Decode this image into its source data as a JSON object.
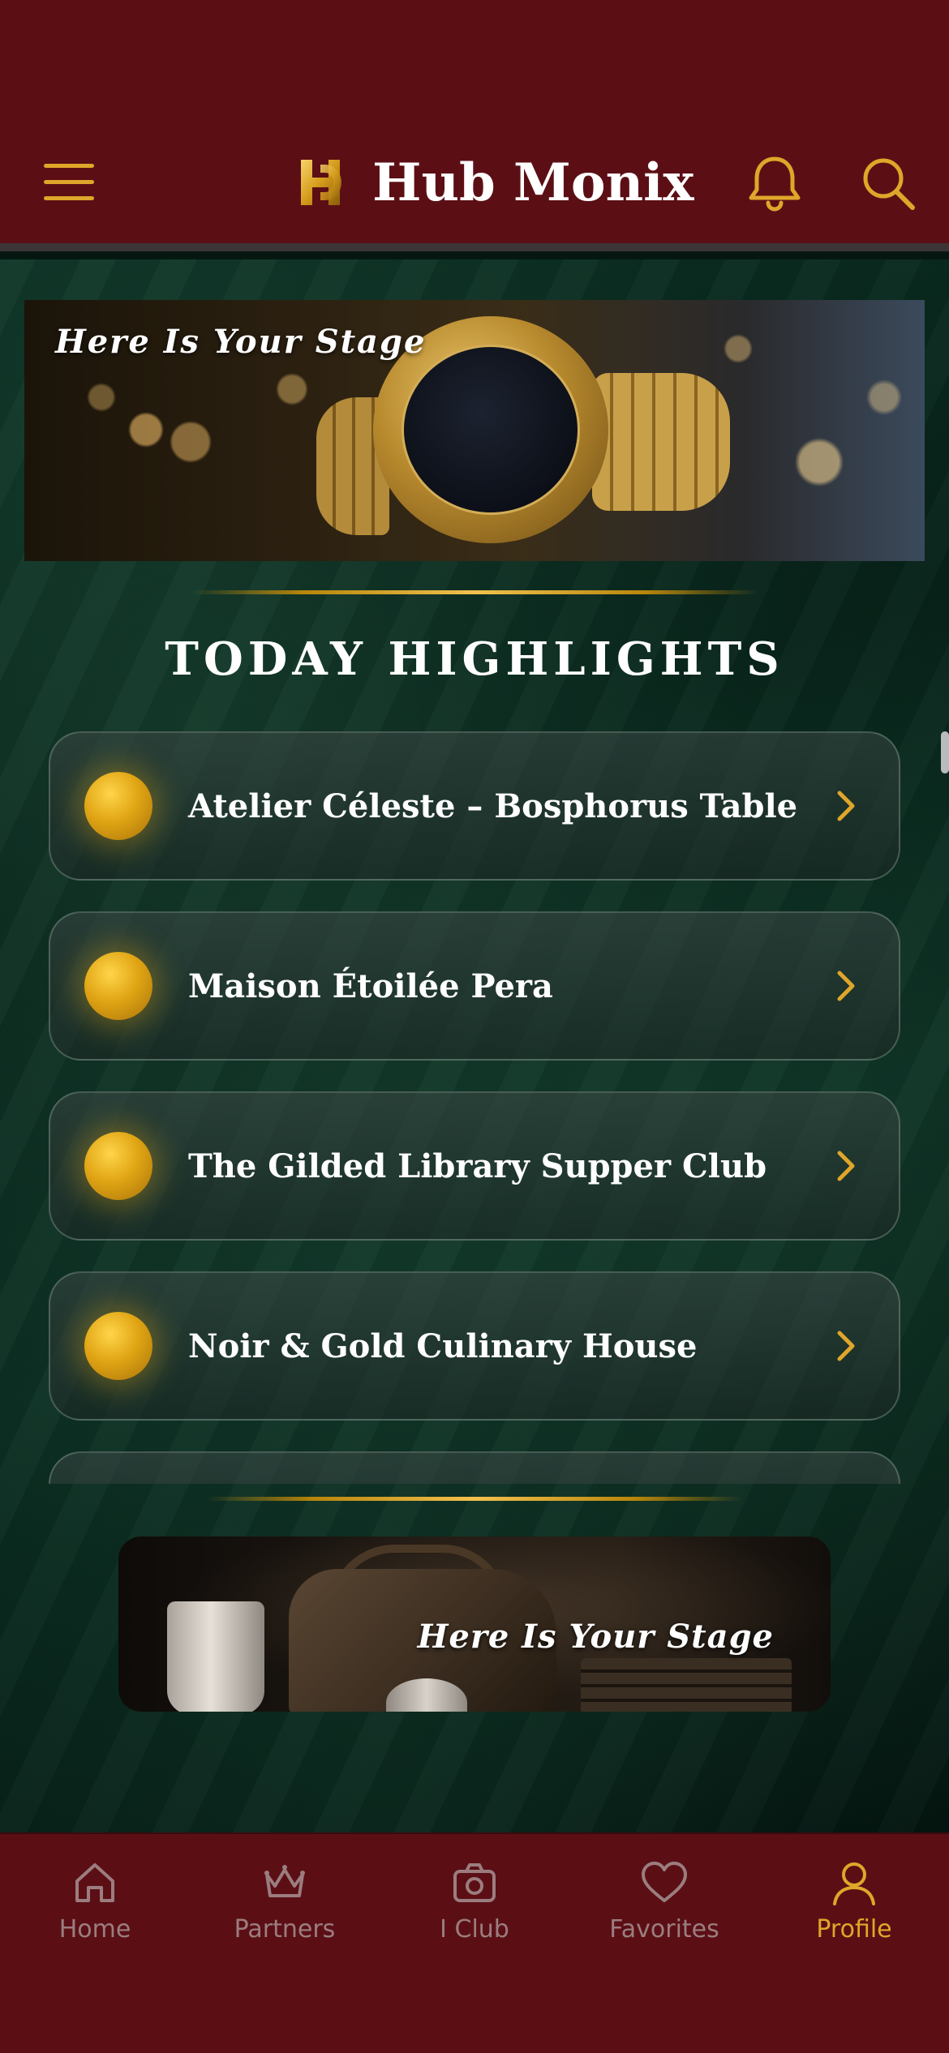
{
  "header": {
    "app_title": "Hub Monix",
    "icons": [
      "menu-icon",
      "logo-icon",
      "bell-icon",
      "search-icon"
    ]
  },
  "banners": {
    "top_text": "Here Is Your Stage",
    "bottom_text": "Here Is Your Stage"
  },
  "highlights": {
    "title": "TODAY HIGHLIGHTS",
    "items": [
      {
        "label": "Atelier Céleste – Bosphorus Table"
      },
      {
        "label": "Maison Étoilée Pera"
      },
      {
        "label": "The Gilded Library Supper Club"
      },
      {
        "label": "Noir & Gold Culinary House"
      },
      {
        "label": ""
      }
    ]
  },
  "tabbar": {
    "tabs": [
      {
        "label": "Home",
        "icon": "home-icon"
      },
      {
        "label": "Partners",
        "icon": "crown-icon"
      },
      {
        "label": "I Club",
        "icon": "camera-icon"
      },
      {
        "label": "Favorites",
        "icon": "heart-icon"
      },
      {
        "label": "Profile",
        "icon": "profile-icon"
      }
    ],
    "active": "Profile"
  },
  "colors": {
    "header_bg": "#5b0f15",
    "accent_gold": "#e0a62a",
    "tab_inactive": "#9b7d7f",
    "background_green": "#072219"
  }
}
